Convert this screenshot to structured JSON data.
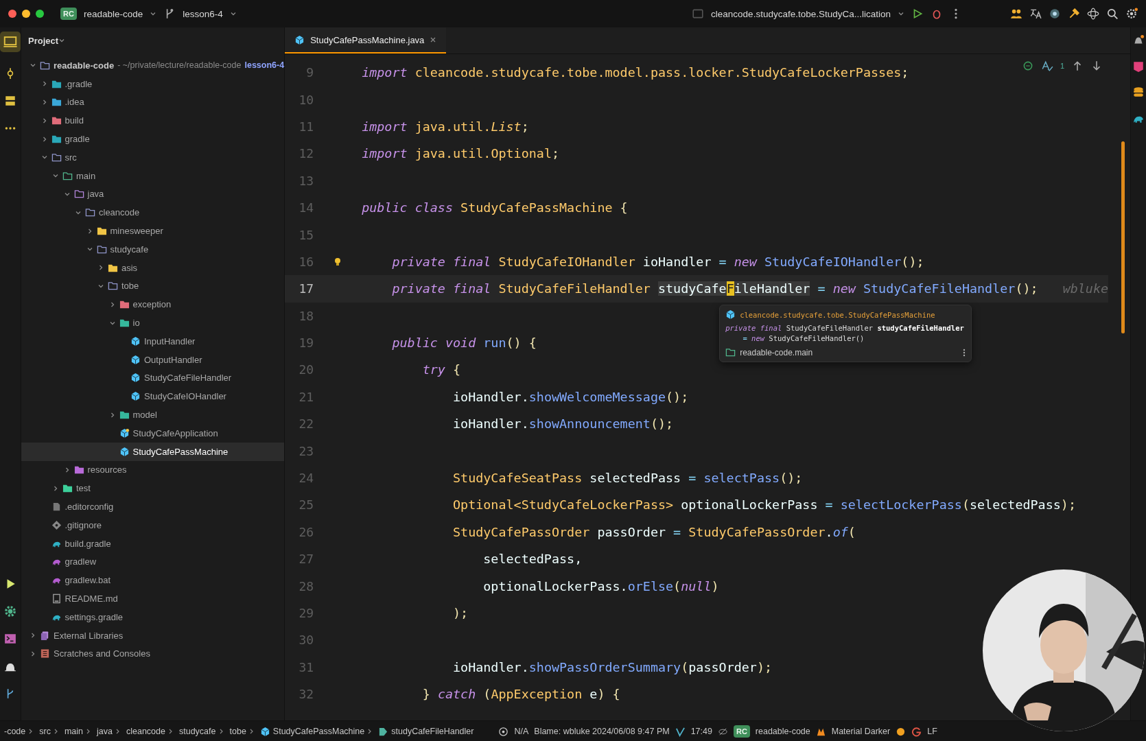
{
  "title_bar": {
    "project_badge": "RC",
    "project": "readable-code",
    "branch": "lesson6-4",
    "run_config": "cleancode.studycafe.tobe.StudyCa...lication"
  },
  "tabs": [
    {
      "label": "StudyCafePassMachine.java",
      "selected": true
    }
  ],
  "project_panel": {
    "title": "Project",
    "tree": [
      {
        "label": "readable-code",
        "path": "- ~/private/lecture/readable-code",
        "branch": "lesson6-4",
        "kind": "folder",
        "expanded": true,
        "selected": false,
        "children": [
          {
            "label": ".gradle",
            "kind": "gradlefolder",
            "expanded": false,
            "selected": false
          },
          {
            "label": ".idea",
            "kind": "ideafolder",
            "expanded": false,
            "selected": false
          },
          {
            "label": "build",
            "kind": "excludedfolder",
            "expanded": false,
            "selected": false
          },
          {
            "label": "gradle",
            "kind": "gradlefolder",
            "expanded": false,
            "selected": false
          },
          {
            "label": "src",
            "kind": "sourceroot",
            "expanded": true,
            "selected": false,
            "children": [
              {
                "label": "main",
                "kind": "module",
                "expanded": true,
                "selected": false,
                "children": [
                  {
                    "label": "java",
                    "kind": "javaroot",
                    "expanded": true,
                    "selected": false,
                    "children": [
                      {
                        "label": "cleancode",
                        "kind": "folder",
                        "expanded": true,
                        "selected": false,
                        "children": [
                          {
                            "label": "minesweeper",
                            "kind": "package",
                            "expanded": false,
                            "selected": false
                          },
                          {
                            "label": "studycafe",
                            "kind": "folder",
                            "expanded": true,
                            "selected": false,
                            "children": [
                              {
                                "label": "asis",
                                "kind": "package",
                                "expanded": false,
                                "selected": false
                              },
                              {
                                "label": "tobe",
                                "kind": "folder",
                                "expanded": true,
                                "selected": false,
                                "children": [
                                  {
                                    "label": "exception",
                                    "kind": "excludedfolder",
                                    "expanded": false,
                                    "selected": false
                                  },
                                  {
                                    "label": "io",
                                    "kind": "tealfolder",
                                    "expanded": true,
                                    "selected": false,
                                    "children": [
                                      {
                                        "label": "InputHandler",
                                        "kind": "class",
                                        "selected": false
                                      },
                                      {
                                        "label": "OutputHandler",
                                        "kind": "class",
                                        "selected": false
                                      },
                                      {
                                        "label": "StudyCafeFileHandler",
                                        "kind": "class",
                                        "selected": false
                                      },
                                      {
                                        "label": "StudyCafeIOHandler",
                                        "kind": "class",
                                        "selected": false
                                      }
                                    ]
                                  },
                                  {
                                    "label": "model",
                                    "kind": "tealfolder",
                                    "expanded": false,
                                    "selected": false
                                  },
                                  {
                                    "label": "StudyCafeApplication",
                                    "kind": "appclass",
                                    "selected": false
                                  },
                                  {
                                    "label": "StudyCafePassMachine",
                                    "kind": "class",
                                    "selected": true
                                  }
                                ]
                              }
                            ]
                          }
                        ]
                      }
                    ]
                  },
                  {
                    "label": "resources",
                    "kind": "resources",
                    "expanded": false,
                    "selected": false
                  }
                ]
              },
              {
                "label": "test",
                "kind": "testroot",
                "expanded": false,
                "selected": false
              }
            ]
          },
          {
            "label": ".editorconfig",
            "kind": "config",
            "selected": false
          },
          {
            "label": ".gitignore",
            "kind": "gitignore",
            "selected": false
          },
          {
            "label": "build.gradle",
            "kind": "gradlefile",
            "selected": false
          },
          {
            "label": "gradlew",
            "kind": "wrapper",
            "selected": false
          },
          {
            "label": "gradlew.bat",
            "kind": "wrapper",
            "selected": false
          },
          {
            "label": "README.md",
            "kind": "markdown",
            "selected": false
          },
          {
            "label": "settings.gradle",
            "kind": "gradlefile",
            "selected": false
          }
        ]
      },
      {
        "label": "External Libraries",
        "kind": "libraries",
        "expanded": false,
        "selected": false
      },
      {
        "label": "Scratches and Consoles",
        "kind": "scratches",
        "expanded": false,
        "selected": false
      }
    ]
  },
  "editor": {
    "inspection_count": "1",
    "lines": [
      {
        "number": "9",
        "current": false,
        "tokens": [
          {
            "kind": "kw",
            "text": "import "
          },
          {
            "kind": "type",
            "text": "cleancode.studycafe.tobe.model.pass.locker.StudyCafeLockerPasses"
          },
          {
            "kind": "punc",
            "text": ";"
          }
        ]
      },
      {
        "number": "10",
        "current": false
      },
      {
        "number": "11",
        "current": false,
        "tokens": [
          {
            "kind": "kw",
            "text": "import "
          },
          {
            "kind": "type",
            "text": "java.util."
          },
          {
            "kind": "typei",
            "text": "List"
          },
          {
            "kind": "punc",
            "text": ";"
          }
        ]
      },
      {
        "number": "12",
        "current": false,
        "tokens": [
          {
            "kind": "kw",
            "text": "import "
          },
          {
            "kind": "type",
            "text": "java.util.Optional"
          },
          {
            "kind": "punc",
            "text": ";"
          }
        ]
      },
      {
        "number": "13",
        "current": false
      },
      {
        "number": "14",
        "current": false,
        "tokens": [
          {
            "kind": "kw",
            "text": "public class "
          },
          {
            "kind": "type",
            "text": "StudyCafePassMachine"
          },
          {
            "kind": "punc",
            "text": " {"
          }
        ]
      },
      {
        "number": "15",
        "current": false
      },
      {
        "number": "16",
        "current": false,
        "bulb": true,
        "tokens": [
          {
            "kind": "kw",
            "text": "    private final "
          },
          {
            "kind": "type",
            "text": "StudyCafeIOHandler"
          },
          {
            "kind": "id",
            "text": " ioHandler "
          },
          {
            "kind": "op",
            "text": "= "
          },
          {
            "kind": "kw",
            "text": "new "
          },
          {
            "kind": "call",
            "text": "StudyCafeIOHandler"
          },
          {
            "kind": "punc",
            "text": "();"
          }
        ]
      },
      {
        "number": "17",
        "current": true,
        "blame": "wbluke",
        "tokens": [
          {
            "kind": "kw",
            "text": "    private final "
          },
          {
            "kind": "type",
            "text": "StudyCafeFileHandler "
          },
          {
            "kind": "sel",
            "text": "studyCafe"
          },
          {
            "kind": "caret",
            "text": "F"
          },
          {
            "kind": "sel",
            "text": "ileHandler"
          },
          {
            "kind": "op",
            "text": " = "
          },
          {
            "kind": "kw",
            "text": "new "
          },
          {
            "kind": "call",
            "text": "StudyCafeFileHandler"
          },
          {
            "kind": "punc",
            "text": "();"
          }
        ]
      },
      {
        "number": "18",
        "current": false
      },
      {
        "number": "19",
        "current": false,
        "tokens": [
          {
            "kind": "kw",
            "text": "    public void "
          },
          {
            "kind": "call",
            "text": "run"
          },
          {
            "kind": "punc",
            "text": "() {"
          }
        ]
      },
      {
        "number": "20",
        "current": false,
        "tokens": [
          {
            "kind": "kw",
            "text": "        try"
          },
          {
            "kind": "punc",
            "text": " {"
          }
        ]
      },
      {
        "number": "21",
        "current": false,
        "tokens": [
          {
            "kind": "id",
            "text": "            ioHandler."
          },
          {
            "kind": "call",
            "text": "showWelcomeMessage"
          },
          {
            "kind": "punc",
            "text": "();"
          }
        ]
      },
      {
        "number": "22",
        "current": false,
        "tokens": [
          {
            "kind": "id",
            "text": "            ioHandler."
          },
          {
            "kind": "call",
            "text": "showAnnouncement"
          },
          {
            "kind": "punc",
            "text": "();"
          }
        ]
      },
      {
        "number": "23",
        "current": false
      },
      {
        "number": "24",
        "current": false,
        "tokens": [
          {
            "kind": "type",
            "text": "            StudyCafeSeatPass"
          },
          {
            "kind": "id",
            "text": " selectedPass "
          },
          {
            "kind": "op",
            "text": "= "
          },
          {
            "kind": "call",
            "text": "selectPass"
          },
          {
            "kind": "punc",
            "text": "();"
          }
        ]
      },
      {
        "number": "25",
        "current": false,
        "tokens": [
          {
            "kind": "type",
            "text": "            Optional<StudyCafeLockerPass>"
          },
          {
            "kind": "id",
            "text": " optionalLockerPass "
          },
          {
            "kind": "op",
            "text": "= "
          },
          {
            "kind": "call",
            "text": "selectLockerPass"
          },
          {
            "kind": "punc",
            "text": "("
          },
          {
            "kind": "id",
            "text": "selectedPass"
          },
          {
            "kind": "punc",
            "text": ");"
          }
        ]
      },
      {
        "number": "26",
        "current": false,
        "tokens": [
          {
            "kind": "type",
            "text": "            StudyCafePassOrder"
          },
          {
            "kind": "id",
            "text": " passOrder "
          },
          {
            "kind": "op",
            "text": "= "
          },
          {
            "kind": "type",
            "text": "StudyCafePassOrder"
          },
          {
            "kind": "id",
            "text": "."
          },
          {
            "kind": "calli",
            "text": "of"
          },
          {
            "kind": "punc",
            "text": "("
          }
        ]
      },
      {
        "number": "27",
        "current": false,
        "tokens": [
          {
            "kind": "id",
            "text": "                selectedPass,"
          }
        ]
      },
      {
        "number": "28",
        "current": false,
        "tokens": [
          {
            "kind": "id",
            "text": "                optionalLockerPass."
          },
          {
            "kind": "call",
            "text": "orElse"
          },
          {
            "kind": "punc",
            "text": "("
          },
          {
            "kind": "kw",
            "text": "null"
          },
          {
            "kind": "punc",
            "text": ")"
          }
        ]
      },
      {
        "number": "29",
        "current": false,
        "tokens": [
          {
            "kind": "punc",
            "text": "            );"
          }
        ]
      },
      {
        "number": "30",
        "current": false
      },
      {
        "number": "31",
        "current": false,
        "tokens": [
          {
            "kind": "id",
            "text": "            ioHandler."
          },
          {
            "kind": "call",
            "text": "showPassOrderSummary"
          },
          {
            "kind": "punc",
            "text": "("
          },
          {
            "kind": "id",
            "text": "passOrder"
          },
          {
            "kind": "punc",
            "text": ");"
          }
        ]
      },
      {
        "number": "32",
        "current": false,
        "tokens": [
          {
            "kind": "punc",
            "text": "        } "
          },
          {
            "kind": "kw",
            "text": "catch "
          },
          {
            "kind": "punc",
            "text": "("
          },
          {
            "kind": "type",
            "text": "AppException"
          },
          {
            "kind": "id",
            "text": " e"
          },
          {
            "kind": "punc",
            "text": ") {"
          }
        ]
      }
    ]
  },
  "popup": {
    "location": "cleancode.studycafe.tobe.StudyCafePassMachine",
    "declaration": [
      [
        {
          "kind": "kw",
          "text": "private final"
        },
        {
          "kind": "id",
          "text": " StudyCafeFileHandler "
        },
        {
          "kind": "bold",
          "text": "studyCafeFileHandler"
        }
      ],
      [
        {
          "kind": "op",
          "text": "    = "
        },
        {
          "kind": "kw",
          "text": "new"
        },
        {
          "kind": "id",
          "text": " StudyCafeFileHandler()"
        }
      ]
    ],
    "module": "readable-code.main"
  },
  "status_bar": {
    "breadcrumbs": [
      {
        "label": "-code",
        "kind": "text"
      },
      {
        "label": "src",
        "kind": "text"
      },
      {
        "label": "main",
        "kind": "text"
      },
      {
        "label": "java",
        "kind": "text"
      },
      {
        "label": "cleancode",
        "kind": "text"
      },
      {
        "label": "studycafe",
        "kind": "text"
      },
      {
        "label": "tobe",
        "kind": "text"
      },
      {
        "label": "StudyCafePassMachine",
        "kind": "class"
      },
      {
        "label": "studyCafeFileHandler",
        "kind": "field"
      }
    ],
    "vcs": "N/A",
    "blame": "Blame: wbluke 2024/06/08 9:47 PM",
    "position": "17:49",
    "project_badge": "RC",
    "project": "readable-code",
    "theme": "Material Darker",
    "line_separator": "LF"
  }
}
